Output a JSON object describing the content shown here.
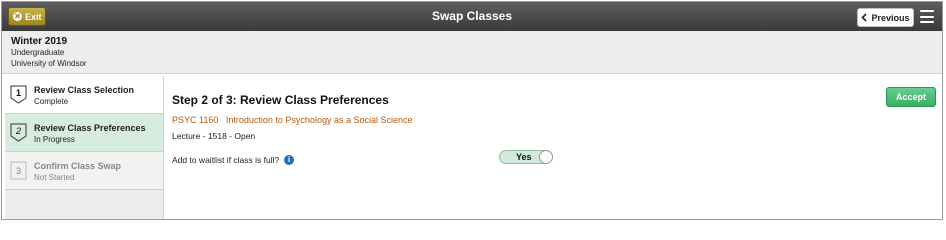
{
  "header": {
    "exit_label": "Exit",
    "title": "Swap Classes",
    "previous_label": "Previous"
  },
  "term_info": {
    "term": "Winter 2019",
    "career": "Undergraduate",
    "institution": "University of Windsor"
  },
  "steps": [
    {
      "number": "1",
      "title": "Review Class Selection",
      "status": "Complete"
    },
    {
      "number": "2",
      "title": "Review Class Preferences",
      "status": "In Progress"
    },
    {
      "number": "3",
      "title": "Confirm Class Swap",
      "status": "Not Started"
    }
  ],
  "main": {
    "title": "Step 2 of 3: Review Class Preferences",
    "accept_label": "Accept",
    "class_code": "PSYC 1160",
    "class_name": "Introduction to Psychology as a Social Science",
    "section_info": "Lecture - 1518 - Open",
    "waitlist_label": "Add to waitlist if class is full?",
    "waitlist_value": "Yes"
  },
  "colors": {
    "header_bg": "#4a4a4a",
    "accent_green": "#38b062",
    "active_step_bg": "#d5ecdf",
    "class_link": "#b85a0e",
    "info_icon": "#1f6fc0"
  },
  "icons": {
    "exit": "close-circle-icon",
    "previous": "chevron-left-icon",
    "menu": "hamburger-menu-icon",
    "info": "info-icon"
  }
}
